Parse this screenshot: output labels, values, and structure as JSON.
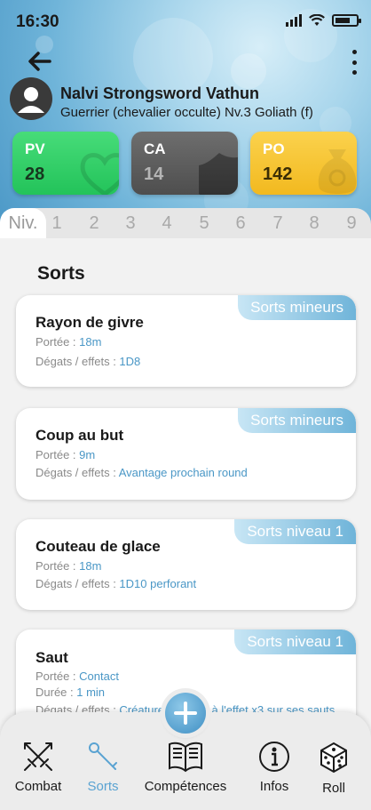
{
  "status": {
    "time": "16:30"
  },
  "character": {
    "name": "Nalvi Strongsword Vathun",
    "subtitle": "Guerrier (chevalier occulte) Nv.3 Goliath (f)"
  },
  "stats": [
    {
      "label": "PV",
      "value": "28",
      "color": "#2ccb62",
      "icon": "heart-icon"
    },
    {
      "label": "CA",
      "value": "14",
      "color": "#5a5a5a",
      "icon": "shield-icon"
    },
    {
      "label": "PO",
      "value": "142",
      "color": "#f5bf28",
      "icon": "coin-bag-icon"
    }
  ],
  "levels": {
    "active": "Niv.",
    "items": [
      "1",
      "2",
      "3",
      "4",
      "5",
      "6",
      "7",
      "8",
      "9"
    ]
  },
  "section_title": "Sorts",
  "spells": [
    {
      "badge": "Sorts mineurs",
      "title": "Rayon de givre",
      "rows": [
        {
          "label": "Portée : ",
          "value": "18m"
        },
        {
          "label": "Dégats / effets : ",
          "value": "1D8"
        }
      ]
    },
    {
      "badge": "Sorts mineurs",
      "title": "Coup au but",
      "rows": [
        {
          "label": "Portée : ",
          "value": "9m"
        },
        {
          "label": "Dégats / effets : ",
          "value": "Avantage prochain round"
        }
      ]
    },
    {
      "badge": "Sorts niveau 1",
      "title": "Couteau de glace",
      "rows": [
        {
          "label": "Portée : ",
          "value": "18m"
        },
        {
          "label": "Dégats / effets : ",
          "value": "1D10 perforant"
        }
      ]
    },
    {
      "badge": "Sorts niveau 1",
      "title": "Saut",
      "rows": [
        {
          "label": "Portée : ",
          "value": "Contact"
        },
        {
          "label": "Durée : ",
          "value": "1 min"
        },
        {
          "label": "Dégats / effets : ",
          "value": "Créature touchée à l'effet x3 sur ses sauts"
        }
      ]
    }
  ],
  "nav": [
    {
      "label": "Combat",
      "icon": "crossed-swords-icon",
      "active": false
    },
    {
      "label": "Sorts",
      "icon": "wand-icon",
      "active": true
    },
    {
      "label": "Compétences",
      "icon": "book-icon",
      "active": false
    },
    {
      "label": "Infos",
      "icon": "info-icon",
      "active": false
    },
    {
      "label": "Roll",
      "icon": "dice-icon",
      "active": false
    }
  ],
  "colors": {
    "accent": "#5aa3d2",
    "badge": "#6fb4d9"
  }
}
